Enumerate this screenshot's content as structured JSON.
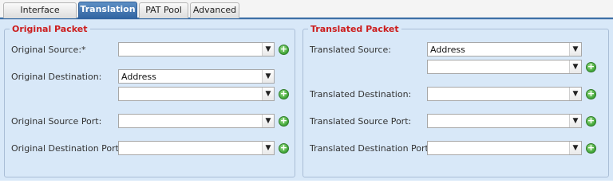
{
  "tabs": [
    {
      "label": "Interface Objects"
    },
    {
      "label": "Translation"
    },
    {
      "label": "PAT Pool"
    },
    {
      "label": "Advanced"
    }
  ],
  "active_tab": "Translation",
  "original_packet": {
    "legend": "Original Packet",
    "source_label": "Original Source:*",
    "source_value": "",
    "destination_label": "Original Destination:",
    "destination_type": "Address",
    "destination_value": "",
    "source_port_label": "Original Source Port:",
    "source_port_value": "",
    "destination_port_label": "Original Destination Port:",
    "destination_port_value": ""
  },
  "translated_packet": {
    "legend": "Translated Packet",
    "source_label": "Translated Source:",
    "source_type": "Address",
    "source_value": "",
    "destination_label": "Translated Destination:",
    "destination_value": "",
    "source_port_label": "Translated Source Port:",
    "source_port_value": "",
    "destination_port_label": "Translated Destination Port:",
    "destination_port_value": ""
  },
  "icons": {
    "dropdown": "chevron-down-icon",
    "add": "add-icon",
    "accent": "#cc1d1d",
    "active_tab_color": "#3b6fa6",
    "add_color": "#3fa536"
  }
}
